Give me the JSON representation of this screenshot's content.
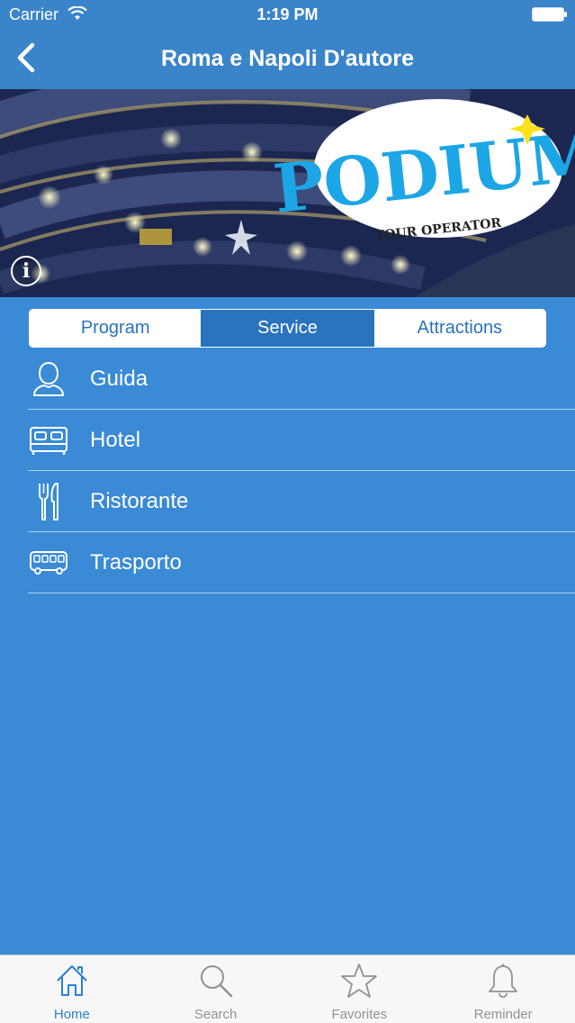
{
  "status_bar": {
    "carrier": "Carrier",
    "time": "1:19 PM"
  },
  "nav": {
    "title": "Roma e Napoli D'autore",
    "back_icon": "chevron-left-icon"
  },
  "banner": {
    "logo_text": "PODIUM",
    "logo_subtext": "TOUR OPERATOR",
    "info_icon": "info-icon"
  },
  "segments": [
    {
      "label": "Program",
      "active": false
    },
    {
      "label": "Service",
      "active": true
    },
    {
      "label": "Attractions",
      "active": false
    }
  ],
  "services": [
    {
      "label": "Guida",
      "icon": "person-icon"
    },
    {
      "label": "Hotel",
      "icon": "bed-icon"
    },
    {
      "label": "Ristorante",
      "icon": "fork-knife-icon"
    },
    {
      "label": "Trasporto",
      "icon": "bus-icon"
    }
  ],
  "tabs": [
    {
      "label": "Home",
      "icon": "home-icon",
      "active": true
    },
    {
      "label": "Search",
      "icon": "search-icon",
      "active": false
    },
    {
      "label": "Favorites",
      "icon": "star-icon",
      "active": false
    },
    {
      "label": "Reminder",
      "icon": "bell-icon",
      "active": false
    }
  ],
  "colors": {
    "background": "#3a8ad6",
    "header": "#3a84c9",
    "segment_active": "#2a73bd",
    "tab_active": "#2a7fd4"
  }
}
